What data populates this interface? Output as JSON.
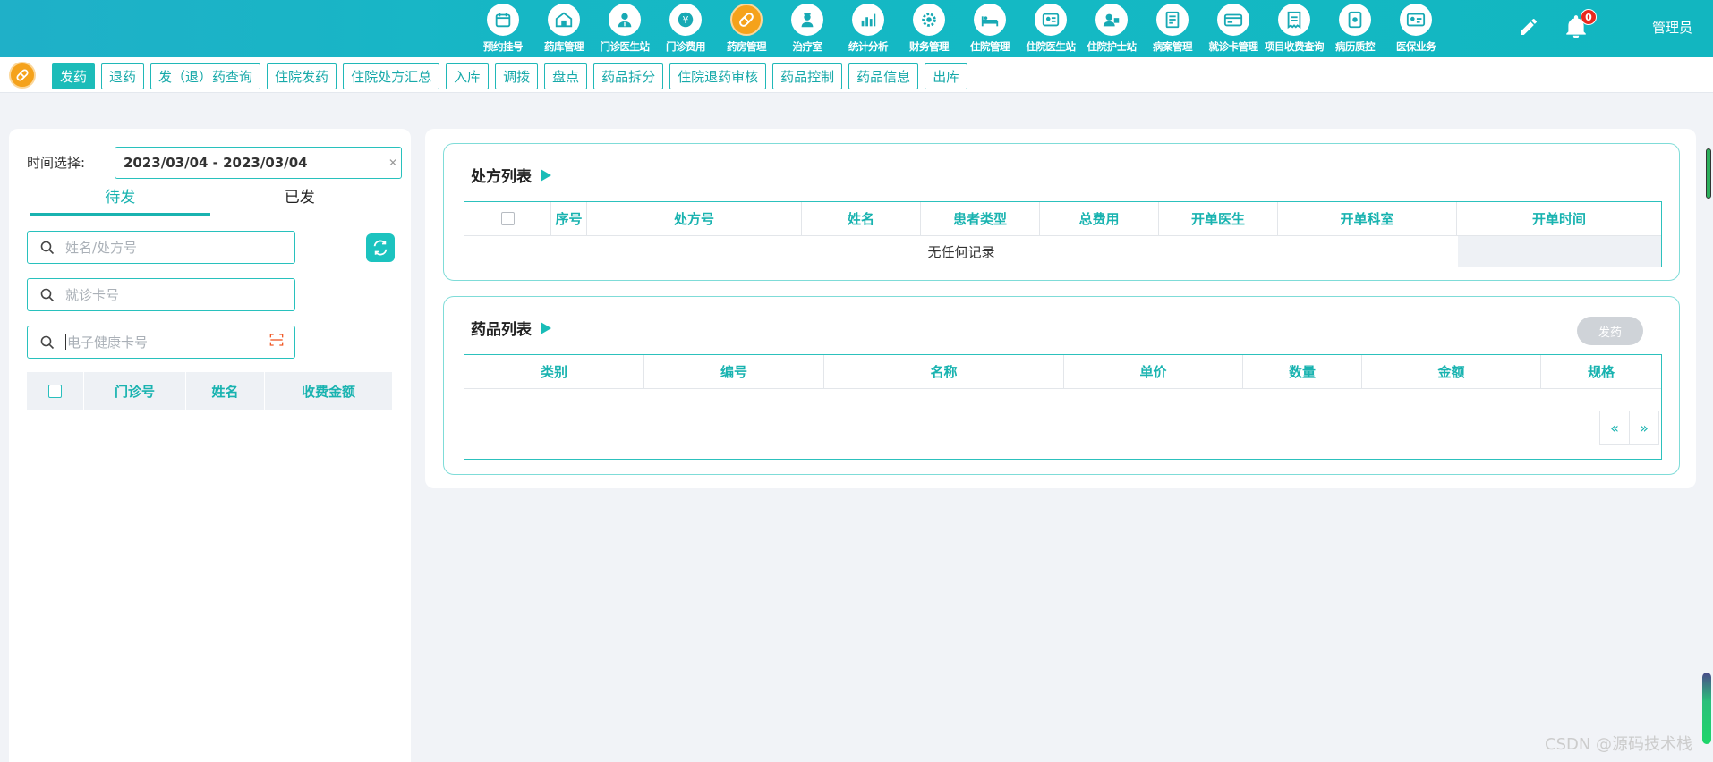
{
  "nav": {
    "items": [
      {
        "label": "预约挂号",
        "icon": "calendar-icon",
        "active": false
      },
      {
        "label": "药库管理",
        "icon": "warehouse-icon",
        "active": false
      },
      {
        "label": "门诊医生站",
        "icon": "doctor-icon",
        "active": false
      },
      {
        "label": "门诊费用",
        "icon": "yuan-icon",
        "active": false
      },
      {
        "label": "药房管理",
        "icon": "pill-icon",
        "active": true
      },
      {
        "label": "治疗室",
        "icon": "nurse-icon",
        "active": false
      },
      {
        "label": "统计分析",
        "icon": "chart-icon",
        "active": false
      },
      {
        "label": "财务管理",
        "icon": "gear-icon",
        "active": false
      },
      {
        "label": "住院管理",
        "icon": "bed-icon",
        "active": false
      },
      {
        "label": "住院医生站",
        "icon": "doctor-card-icon",
        "active": false
      },
      {
        "label": "住院护士站",
        "icon": "nurse-card-icon",
        "active": false
      },
      {
        "label": "病案管理",
        "icon": "file-icon",
        "active": false
      },
      {
        "label": "就诊卡管理",
        "icon": "card-icon",
        "active": false
      },
      {
        "label": "项目收费查询",
        "icon": "receipt-icon",
        "active": false
      },
      {
        "label": "病历质控",
        "icon": "record-icon",
        "active": false
      },
      {
        "label": "医保业务",
        "icon": "insurance-icon",
        "active": false
      }
    ],
    "bell_count": "0",
    "user": "管理员"
  },
  "subnav": {
    "tabs": [
      "发药",
      "退药",
      "发（退）药查询",
      "住院发药",
      "住院处方汇总",
      "入库",
      "调拨",
      "盘点",
      "药品拆分",
      "住院退药审核",
      "药品控制",
      "药品信息",
      "出库"
    ],
    "active_index": 0
  },
  "left": {
    "time_label": "时间选择:",
    "date_range": "2023/03/04 - 2023/03/04",
    "status_tabs": [
      "待发",
      "已发"
    ],
    "search_name_placeholder": "姓名/处方号",
    "search_card_placeholder": "就诊卡号",
    "search_health_placeholder": "电子健康卡号",
    "table_headers": [
      "",
      "门诊号",
      "姓名",
      "收费金额"
    ]
  },
  "prescription": {
    "title": "处方列表",
    "headers": [
      "",
      "序号",
      "处方号",
      "姓名",
      "患者类型",
      "总费用",
      "开单医生",
      "开单科室",
      "开单时间"
    ],
    "empty_text": "无任何记录"
  },
  "drugs": {
    "title": "药品列表",
    "dispense_button": "发药",
    "headers": [
      "类别",
      "编号",
      "名称",
      "单价",
      "数量",
      "金额",
      "规格"
    ],
    "pager_prev": "«",
    "pager_next": "»"
  },
  "watermark": "CSDN @源码技术栈"
}
